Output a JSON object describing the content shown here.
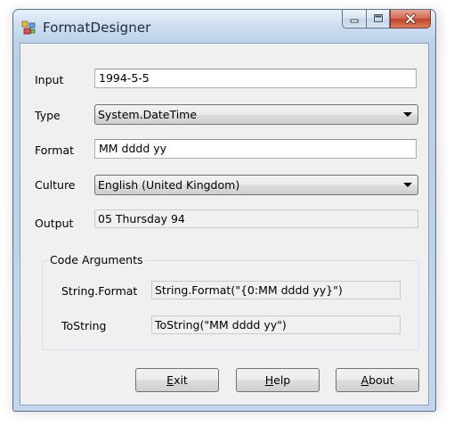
{
  "window": {
    "title": "FormatDesigner"
  },
  "form": {
    "input_label": "Input",
    "input_value": "1994-5-5",
    "type_label": "Type",
    "type_value": "System.DateTime",
    "format_label": "Format",
    "format_value": "MM dddd yy",
    "culture_label": "Culture",
    "culture_value": "English (United Kingdom)",
    "output_label": "Output",
    "output_value": "05 Thursday 94"
  },
  "code_arguments": {
    "legend": "Code Arguments",
    "string_format_label": "String.Format",
    "string_format_value": "String.Format(\"{0:MM dddd yy}\")",
    "tostring_label": "ToString",
    "tostring_value": "ToString(\"MM dddd yy\")"
  },
  "buttons": {
    "exit_mnemonic": "E",
    "exit_rest": "xit",
    "help_mnemonic": "H",
    "help_rest": "elp",
    "about_mnemonic": "A",
    "about_rest": "bout"
  },
  "icons": {
    "app": "app-icon",
    "minimize": "minimize-icon",
    "maximize": "maximize-icon",
    "close": "close-icon",
    "dropdown": "chevron-down-icon"
  },
  "colors": {
    "titlebar": "#cfdff1",
    "client": "#f0f0f0",
    "close_button": "#c2442a"
  }
}
